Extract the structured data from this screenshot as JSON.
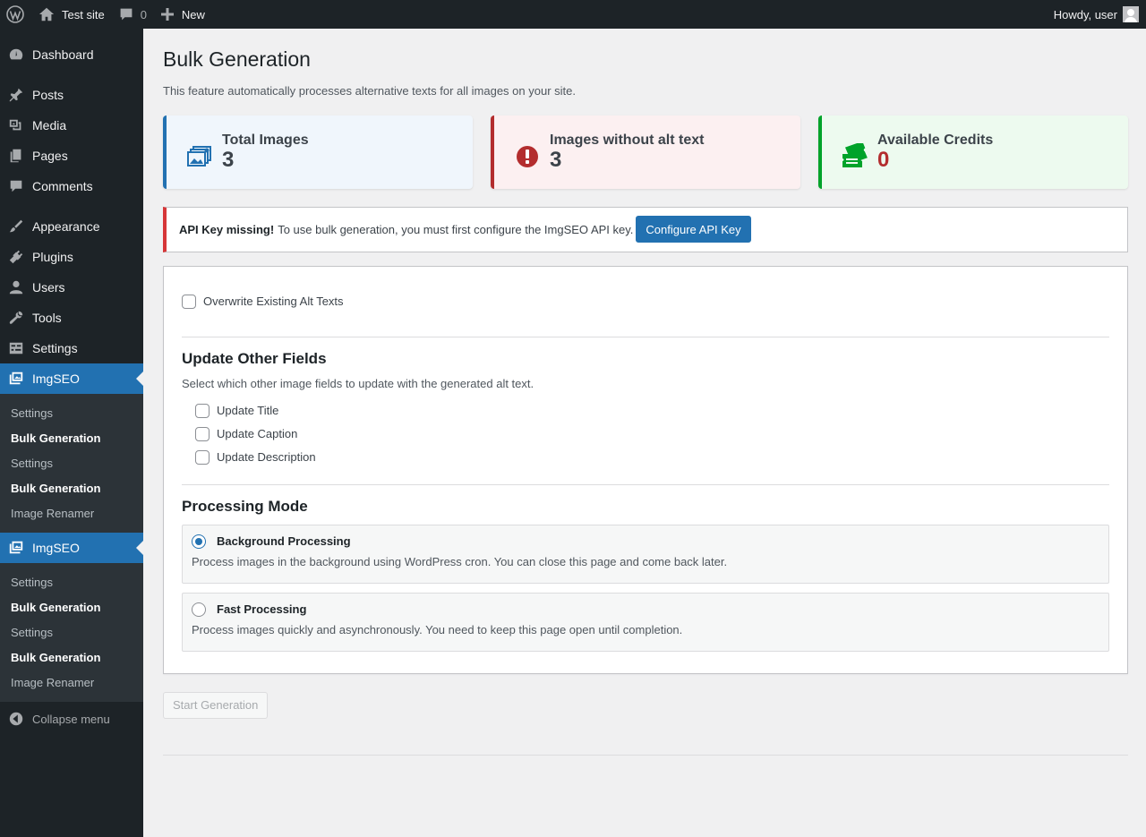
{
  "adminbar": {
    "site_name": "Test site",
    "comments_count": "0",
    "new_label": "New",
    "howdy": "Howdy, user"
  },
  "sidebar": {
    "items": [
      {
        "label": "Dashboard",
        "icon": "dashboard-icon"
      },
      {
        "label": "Posts",
        "icon": "pin-icon"
      },
      {
        "label": "Media",
        "icon": "media-icon"
      },
      {
        "label": "Pages",
        "icon": "pages-icon"
      },
      {
        "label": "Comments",
        "icon": "comment-icon"
      },
      {
        "label": "Appearance",
        "icon": "brush-icon"
      },
      {
        "label": "Plugins",
        "icon": "plug-icon"
      },
      {
        "label": "Users",
        "icon": "user-icon"
      },
      {
        "label": "Tools",
        "icon": "wrench-icon"
      },
      {
        "label": "Settings",
        "icon": "settings-icon"
      }
    ],
    "imgseo_groups": [
      {
        "label": "ImgSEO",
        "sub": [
          "Settings",
          "Bulk Generation",
          "Settings",
          "Bulk Generation",
          "Image Renamer"
        ]
      },
      {
        "label": "ImgSEO",
        "sub": [
          "Settings",
          "Bulk Generation",
          "Settings",
          "Bulk Generation",
          "Image Renamer"
        ]
      }
    ],
    "collapse_label": "Collapse menu"
  },
  "page": {
    "title": "Bulk Generation",
    "description": "This feature automatically processes alternative texts for all images on your site."
  },
  "stats": [
    {
      "label": "Total Images",
      "value": "3",
      "icon": "images-icon",
      "color": "#2271b1"
    },
    {
      "label": "Images without alt text",
      "value": "3",
      "icon": "warning-icon",
      "color": "#b32d2e"
    },
    {
      "label": "Available Credits",
      "value": "0",
      "icon": "tickets-icon",
      "color": "#00a32a"
    }
  ],
  "notice": {
    "title": "API Key missing!",
    "text": "To use bulk generation, you must first configure the ImgSEO API key.",
    "button": "Configure API Key"
  },
  "options": {
    "overwrite_label": "Overwrite Existing Alt Texts",
    "update_heading": "Update Other Fields",
    "update_desc": "Select which other image fields to update with the generated alt text.",
    "update_fields": [
      "Update Title",
      "Update Caption",
      "Update Description"
    ],
    "mode_heading": "Processing Mode",
    "modes": [
      {
        "title": "Background Processing",
        "desc": "Process images in the background using WordPress cron. You can close this page and come back later.",
        "selected": true
      },
      {
        "title": "Fast Processing",
        "desc": "Process images quickly and asynchronously. You need to keep this page open until completion.",
        "selected": false
      }
    ]
  },
  "start_button": "Start Generation"
}
